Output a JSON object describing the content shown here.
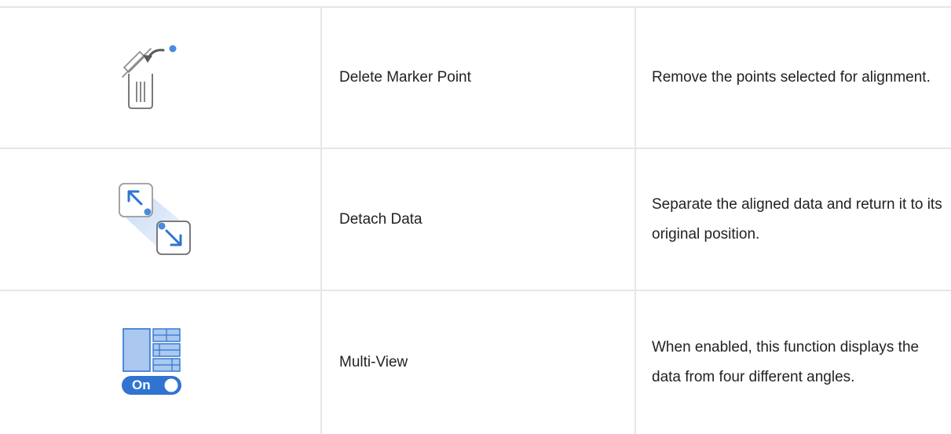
{
  "rows": [
    {
      "icon": "delete-marker-point-icon",
      "name": "Delete Marker Point",
      "description": "Remove the points selected for alignment."
    },
    {
      "icon": "detach-data-icon",
      "name": "Detach Data",
      "description": "Separate the aligned data and return it to its original position."
    },
    {
      "icon": "multi-view-icon",
      "name": "Multi-View",
      "description": "When enabled, this function displays the data from four different angles.",
      "toggle_label": "On"
    }
  ],
  "colors": {
    "border": "#e6e6e6",
    "accent_blue": "#2f74d0",
    "light_blue": "#aac8f0",
    "icon_gray": "#6b6b6b"
  }
}
